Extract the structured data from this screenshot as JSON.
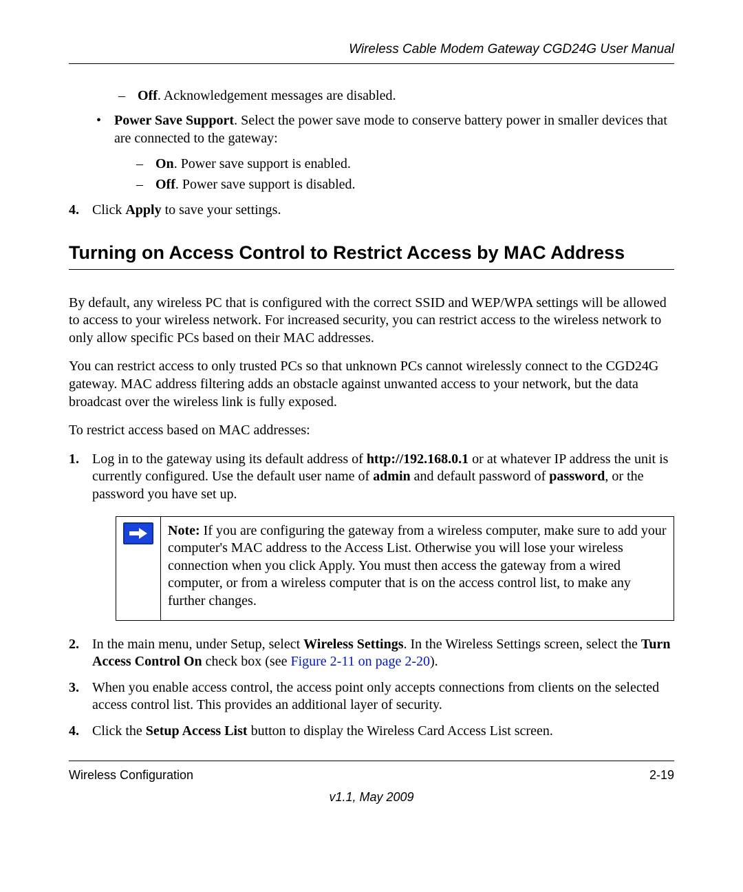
{
  "header": {
    "title": "Wireless Cable Modem Gateway CGD24G User Manual"
  },
  "top_dash": {
    "item": {
      "strong": "Off",
      "rest": ". Acknowledgement messages are disabled."
    }
  },
  "bullet": {
    "pss": {
      "strong": "Power Save Support",
      "rest": ". Select the power save mode to conserve battery power in smaller devices that are connected to the gateway:",
      "on": {
        "strong": "On",
        "rest": ". Power save support is enabled."
      },
      "off": {
        "strong": "Off",
        "rest": ". Power save support is disabled."
      }
    }
  },
  "step4_top": {
    "pre": "Click ",
    "strong": "Apply",
    "post": " to save your settings."
  },
  "section": {
    "heading": "Turning on Access Control to Restrict Access by MAC Address",
    "p1": "By default, any wireless PC that is configured with the correct SSID and WEP/WPA settings will be allowed to access to your wireless network. For increased security, you can restrict access to the wireless network to only allow specific PCs based on their MAC addresses.",
    "p2": "You can restrict access to only trusted PCs so that unknown PCs cannot wirelessly connect to the CGD24G gateway. MAC address filtering adds an obstacle against unwanted access to your network, but the data broadcast over the wireless link is fully exposed.",
    "p3": "To restrict access based on MAC addresses:"
  },
  "steps": {
    "s1": {
      "a": "Log in to the gateway using its default address of ",
      "url": "http://192.168.0.1",
      "b": " or at whatever IP address the unit is currently configured. Use the default user name of ",
      "user": "admin",
      "c": " and default password of ",
      "pass": "password",
      "d": ", or the password you have set up."
    },
    "s2": {
      "a": "In the main menu, under Setup, select ",
      "ws": "Wireless Settings",
      "b": ". In the Wireless Settings screen, select the ",
      "chk": "Turn Access Control On",
      "c": " check box (see ",
      "xref": "Figure 2-11 on page 2-20",
      "d": ")."
    },
    "s3": "When you enable access control, the access point only accepts connections from clients on the selected access control list. This provides an additional layer of security.",
    "s4": {
      "a": "Click the ",
      "btn": "Setup Access List",
      "b": " button to display the Wireless Card Access List screen."
    }
  },
  "note": {
    "label": "Note:",
    "text": " If you are configuring the gateway from a wireless computer, make sure to add your computer's MAC address to the Access List. Otherwise you will lose your wireless connection when you click Apply. You must then access the gateway from a wired computer, or from a wireless computer that is on the access control list, to make any further changes."
  },
  "footer": {
    "left": "Wireless Configuration",
    "right": "2-19",
    "version": "v1.1, May 2009"
  }
}
